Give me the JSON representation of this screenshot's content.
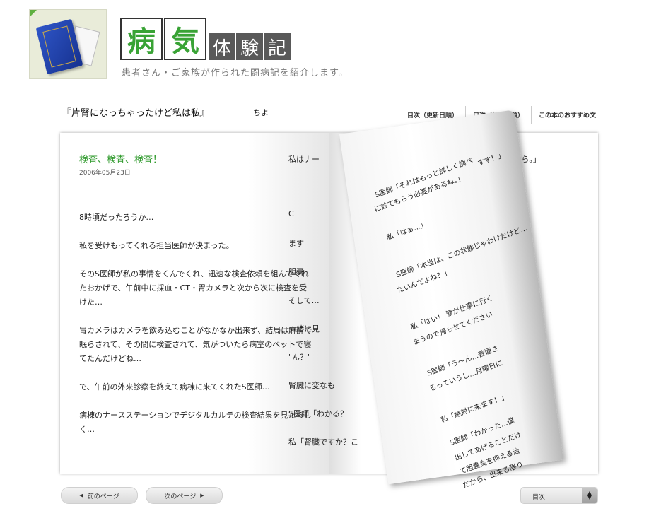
{
  "header": {
    "title_big": [
      "病",
      "気"
    ],
    "title_small": [
      "体",
      "験",
      "記"
    ],
    "subtitle": "患者さん・ご家族が作られた闘病記を紹介します。"
  },
  "book": {
    "title": "『片腎になっちゃったけど私は私』",
    "author": "ちよ",
    "links": [
      "目次（更新日順）",
      "目次（体験日順）",
      "この本のおすすめ文"
    ]
  },
  "left_page": {
    "chapter_title": "検査、検査、検査！",
    "date": "2006年05月23日",
    "paragraphs": [
      "8時頃だったろうか…",
      "私を受けもってくれる担当医師が決まった。",
      "そのS医師が私の事情をくんでくれ、迅速な検査依頼を組んでくれたおかげで、午前中に採血・CT・胃カメラと次から次に検査を受けた…",
      "胃カメラはカメラを飲み込むことがなかなか出来ず、結局は麻酔で眠らされて、その間に検査されて、気がついたら病室のベットで寝てたんだけどね…",
      "で、午前の外来診察を終えて病棟に来てくれたS医師…",
      "病棟のナースステーションでデジタルカルテの検査結果を見たらしく…"
    ]
  },
  "right_page": {
    "lines": [
      "私はナー",
      "してておくから。」",
      "C",
      "ます",
      "胆嚢",
      "そして…",
      "一緒に見",
      "\"ん？\"",
      "腎臓に変なも",
      "S医師「わかる？",
      "私「腎臓ですか？こ"
    ],
    "curl_lines": [
      "S医師「それはもっと詳しく調べ",
      "に診てもらう必要があるね。」",
      "すす！」",
      "私「はぁ…」",
      "S医師「本当は、この状態じゃわけだけど…",
      "たいんだよね？」",
      "私「はい！ 渡が仕事に行く",
      "まうので帰らせてください",
      "S医師「う〜ん…普通さ",
      "るっていうし…月曜日に",
      "私「絶対に来ます！」",
      "S医師「わかった…僕",
      "出してあげることだけ",
      "て胆嚢炎を抑える治",
      "だから、出来る限り"
    ]
  },
  "navigation": {
    "prev_label": "前のページ",
    "next_label": "次のページ",
    "toc_select": "目次"
  }
}
